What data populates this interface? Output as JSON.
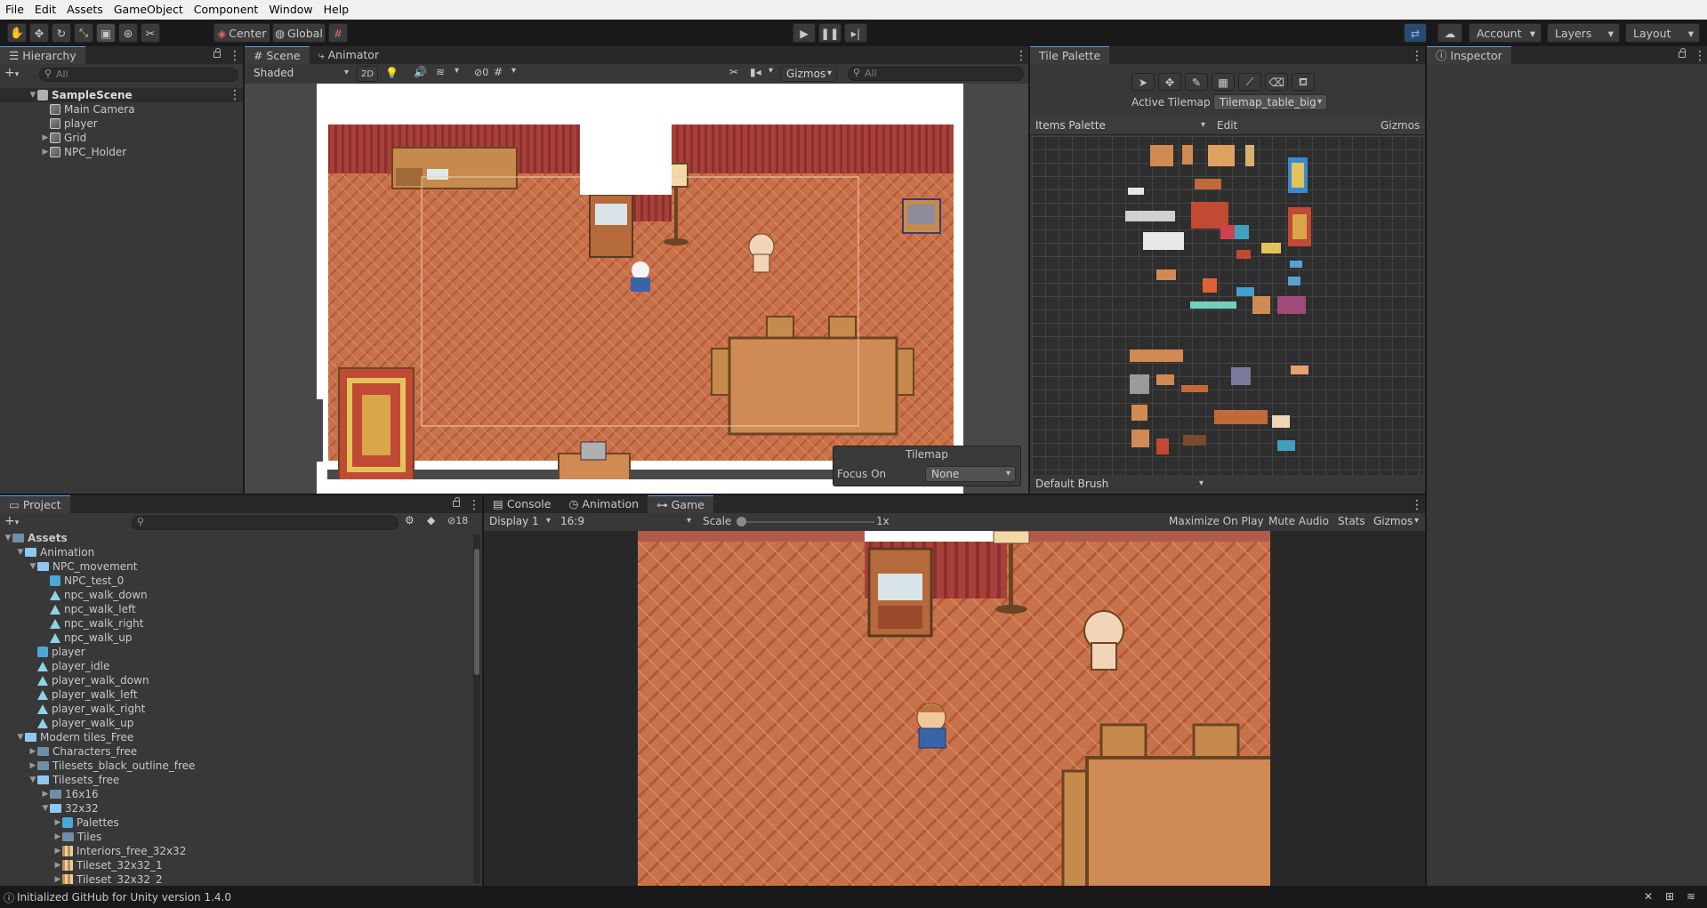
{
  "menu": [
    "File",
    "Edit",
    "Assets",
    "GameObject",
    "Component",
    "Window",
    "Help"
  ],
  "toolbar": {
    "center_label": "Center",
    "global_label": "Global",
    "account_label": "Account",
    "layers_label": "Layers",
    "layout_label": "Layout"
  },
  "hierarchy": {
    "tab": "Hierarchy",
    "search_placeholder": "All",
    "scene": "SampleScene",
    "items": [
      {
        "label": "Main Camera",
        "expandable": false
      },
      {
        "label": "player",
        "expandable": false
      },
      {
        "label": "Grid",
        "expandable": true
      },
      {
        "label": "NPC_Holder",
        "expandable": true
      }
    ]
  },
  "scene_view": {
    "tabs": [
      "Scene",
      "Animator"
    ],
    "shading": "Shaded",
    "mode_2d": "2D",
    "hidden_count": "0",
    "gizmos": "Gizmos",
    "search_placeholder": "All",
    "overlay": {
      "title": "Tilemap",
      "focus_label": "Focus On",
      "focus_value": "None"
    }
  },
  "tile_palette": {
    "tab": "Tile Palette",
    "active_label": "Active Tilemap",
    "active_value": "Tilemap_table_big",
    "palette": "Items Palette",
    "edit": "Edit",
    "gizmos": "Gizmos",
    "brush": "Default Brush"
  },
  "inspector": {
    "tab": "Inspector"
  },
  "project": {
    "tab": "Project",
    "hidden_count": "18",
    "tree": [
      {
        "label": "Assets",
        "indent": 0,
        "arrow": "open",
        "icon": "folder",
        "bold": true
      },
      {
        "label": "Animation",
        "indent": 1,
        "arrow": "open",
        "icon": "folder-lb"
      },
      {
        "label": "NPC_movement",
        "indent": 2,
        "arrow": "open",
        "icon": "folder-lb"
      },
      {
        "label": "NPC_test_0",
        "indent": 3,
        "arrow": "",
        "icon": "ctrl"
      },
      {
        "label": "npc_walk_down",
        "indent": 3,
        "arrow": "",
        "icon": "anim"
      },
      {
        "label": "npc_walk_left",
        "indent": 3,
        "arrow": "",
        "icon": "anim"
      },
      {
        "label": "npc_walk_right",
        "indent": 3,
        "arrow": "",
        "icon": "anim"
      },
      {
        "label": "npc_walk_up",
        "indent": 3,
        "arrow": "",
        "icon": "anim"
      },
      {
        "label": "player",
        "indent": 2,
        "arrow": "",
        "icon": "ctrl"
      },
      {
        "label": "player_idle",
        "indent": 2,
        "arrow": "",
        "icon": "anim"
      },
      {
        "label": "player_walk_down",
        "indent": 2,
        "arrow": "",
        "icon": "anim"
      },
      {
        "label": "player_walk_left",
        "indent": 2,
        "arrow": "",
        "icon": "anim"
      },
      {
        "label": "player_walk_right",
        "indent": 2,
        "arrow": "",
        "icon": "anim"
      },
      {
        "label": "player_walk_up",
        "indent": 2,
        "arrow": "",
        "icon": "anim"
      },
      {
        "label": "Modern tiles_Free",
        "indent": 1,
        "arrow": "open",
        "icon": "folder-lb"
      },
      {
        "label": "Characters_free",
        "indent": 2,
        "arrow": "closed",
        "icon": "folder"
      },
      {
        "label": "Tilesets_black_outline_free",
        "indent": 2,
        "arrow": "closed",
        "icon": "folder"
      },
      {
        "label": "Tilesets_free",
        "indent": 2,
        "arrow": "open",
        "icon": "folder-lb"
      },
      {
        "label": "16x16",
        "indent": 3,
        "arrow": "closed",
        "icon": "folder"
      },
      {
        "label": "32x32",
        "indent": 3,
        "arrow": "open",
        "icon": "folder-lb"
      },
      {
        "label": "Palettes",
        "indent": 4,
        "arrow": "closed",
        "icon": "pal"
      },
      {
        "label": "Tiles",
        "indent": 4,
        "arrow": "closed",
        "icon": "folder"
      },
      {
        "label": "Interiors_free_32x32",
        "indent": 4,
        "arrow": "closed",
        "icon": "tile"
      },
      {
        "label": "Tileset_32x32_1",
        "indent": 4,
        "arrow": "closed",
        "icon": "tile"
      },
      {
        "label": "Tileset_32x32_2",
        "indent": 4,
        "arrow": "closed",
        "icon": "tile"
      }
    ]
  },
  "bottom_tabs": [
    "Console",
    "Animation",
    "Game"
  ],
  "game_view": {
    "display": "Display 1",
    "aspect": "16:9",
    "scale_label": "Scale",
    "scale_value": "1x",
    "buttons": [
      "Maximize On Play",
      "Mute Audio",
      "Stats",
      "Gizmos"
    ]
  },
  "status": {
    "text": "Initialized GitHub for Unity version 1.4.0"
  },
  "colors": {
    "accent": "#4d9fff",
    "panel": "#383838",
    "floor": "#c9714a",
    "wall": "#9c3a34"
  }
}
